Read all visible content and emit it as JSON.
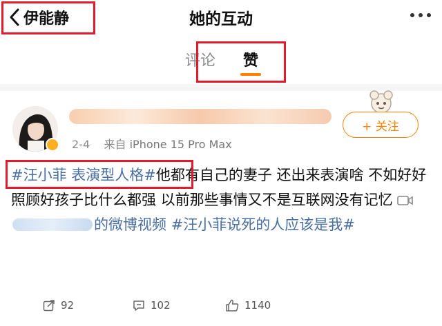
{
  "header": {
    "back_label": "伊能静",
    "title": "她的互动"
  },
  "tabs": [
    {
      "label": "评论",
      "active": false
    },
    {
      "label": "赞",
      "active": true
    }
  ],
  "post": {
    "time": "2-4",
    "source_prefix": "来自",
    "source_device": "iPhone 15 Pro Max",
    "follow_label": "+ 关注",
    "tag_1": "#汪小菲 表演型人格#",
    "text_1": "他都有自己的妻子 还出来表演啥 不如好好照顾好孩子比什么都强 以前那些事情又不是互联网没有记忆",
    "video_suffix": "的微博视频",
    "tag_2": "#汪小菲说死的人应该是我#"
  },
  "actions": {
    "reposts": "92",
    "comments": "102",
    "likes": "1140"
  },
  "colors": {
    "accent": "#ff8200",
    "link": "#4a6fa5",
    "highlight_box": "#e11b2b"
  }
}
